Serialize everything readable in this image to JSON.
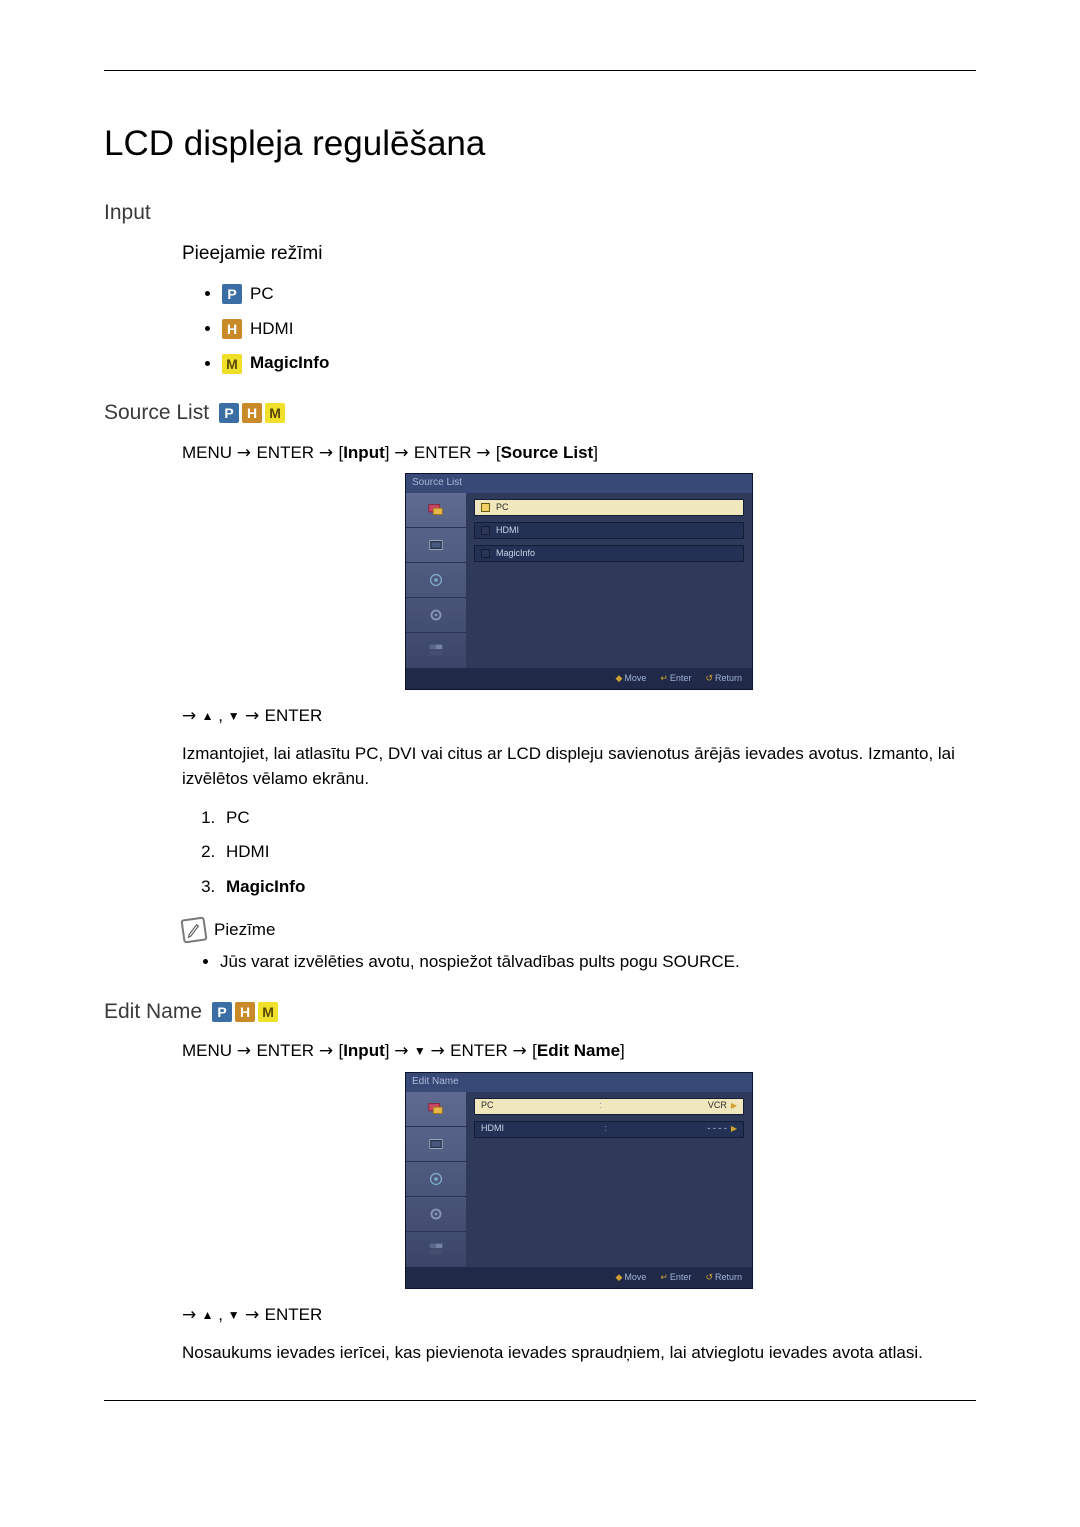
{
  "title": "LCD displeja regulēšana",
  "h_input": "Input",
  "h_modes": "Pieejamie režīmi",
  "modes": {
    "pc": "PC",
    "hdmi": "HDMI",
    "magicinfo": "MagicInfo"
  },
  "h_sourcelist": "Source List",
  "nav1": {
    "menu": "MENU",
    "arrow": " → ",
    "enter": "ENTER",
    "input_br": "Input",
    "source_br": "Source List"
  },
  "osd1": {
    "title": "Source List",
    "items": [
      "PC",
      "HDMI",
      "MagicInfo"
    ],
    "footer": {
      "move": "Move",
      "enter": "Enter",
      "return": "Return"
    }
  },
  "nav_arrows": "→ ▲ , ▼ → ENTER",
  "desc1": "Izmantojiet, lai atlasītu PC, DVI vai citus ar LCD displeju savienotus ārējās ievades avotus. Izmanto, lai izvēlētos vēlamo ekrānu.",
  "list1": [
    "PC",
    "HDMI",
    "MagicInfo"
  ],
  "note_label": "Piezīme",
  "note_text": "Jūs varat izvēlēties avotu, nospiežot tālvadības pults pogu SOURCE.",
  "h_editname": "Edit Name",
  "nav2": {
    "menu": "MENU",
    "enter": "ENTER",
    "input_br": "Input",
    "editname_br": "Edit Name",
    "down": "▼"
  },
  "osd2": {
    "title": "Edit Name",
    "rows": [
      {
        "label": "PC",
        "value": "VCR"
      },
      {
        "label": "HDMI",
        "value": "- - - -"
      }
    ],
    "footer": {
      "move": "Move",
      "enter": "Enter",
      "return": "Return"
    }
  },
  "desc2": "Nosaukums ievades ierīcei, kas pievienota ievades spraudņiem, lai atvieglotu ievades avota atlasi."
}
